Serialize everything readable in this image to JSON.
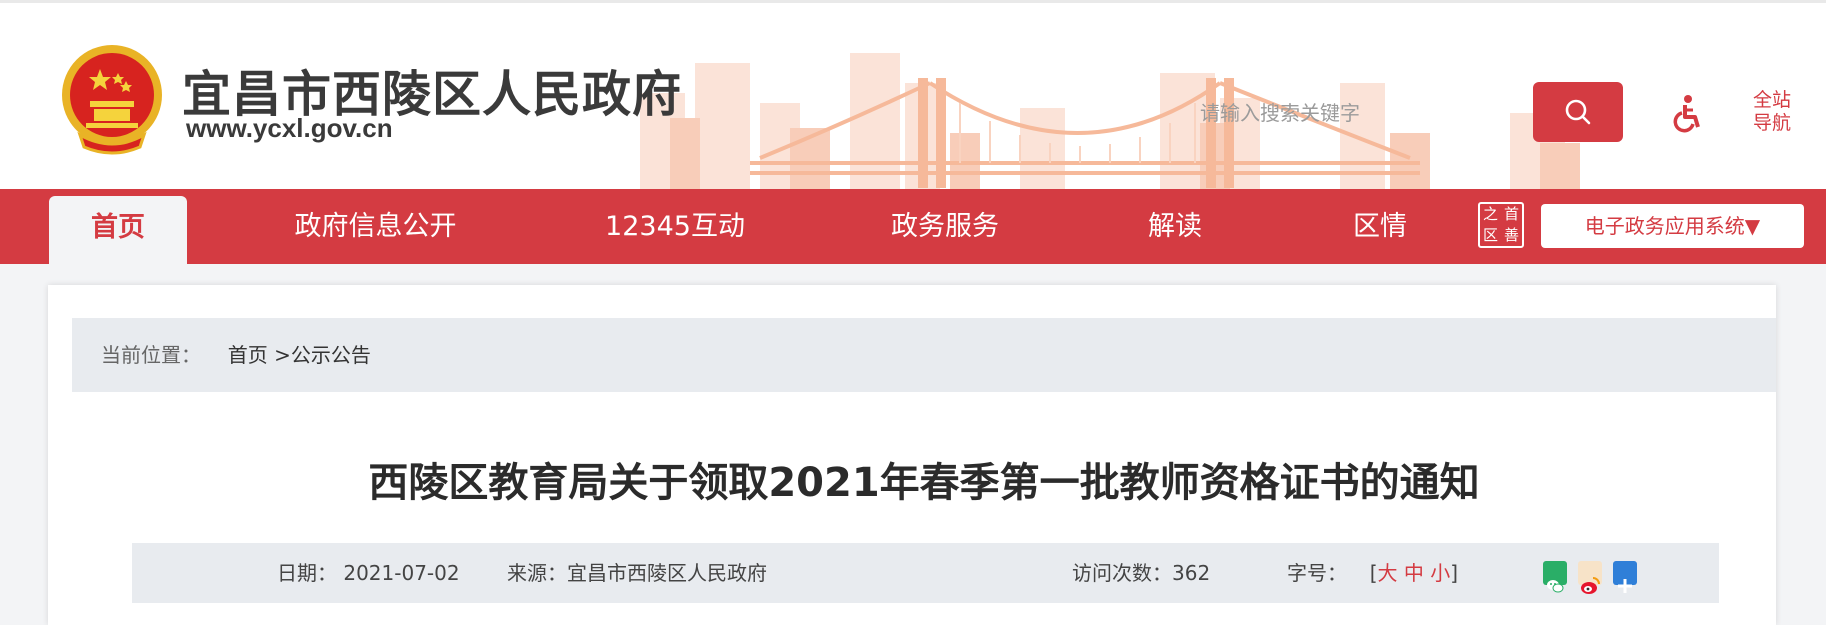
{
  "header": {
    "site_title": "宜昌市西陵区人民政府",
    "site_url": "www.ycxl.gov.cn",
    "search_placeholder": "请输入搜索关键字",
    "fullsite_nav_label_1": "全站",
    "fullsite_nav_label_2": "导航"
  },
  "nav": {
    "items": [
      {
        "label": "首页"
      },
      {
        "label": "政府信息公开"
      },
      {
        "label": "12345互动"
      },
      {
        "label": "政务服务"
      },
      {
        "label": "解读"
      },
      {
        "label": "区情"
      }
    ],
    "gov_icon_chars": [
      "之",
      "首",
      "区",
      "善"
    ],
    "egov_label": "电子政务应用系统▼"
  },
  "breadcrumb": {
    "prefix": "当前位置：",
    "home": "首页",
    "separator": " >",
    "current": "公示公告"
  },
  "article": {
    "title": "西陵区教育局关于领取2021年春季第一批教师资格证书的通知",
    "date_label": "日期：",
    "date": "2021-07-02",
    "source_label": "来源：",
    "source": "宜昌市西陵区人民政府",
    "visits_label": "访问次数：",
    "visits": "362",
    "font_label": "字号：",
    "font_open": "[",
    "font_large": "大",
    "font_medium": "中",
    "font_small": "小",
    "font_close": "]"
  },
  "colors": {
    "accent": "#d43b42",
    "share_wechat": "#2aae67",
    "share_weibo": "#e6162d",
    "share_more": "#2f7fd8"
  },
  "icons": [
    "national-emblem-icon",
    "search-icon",
    "accessibility-icon",
    "wechat-icon",
    "weibo-icon",
    "plus-share-icon"
  ]
}
